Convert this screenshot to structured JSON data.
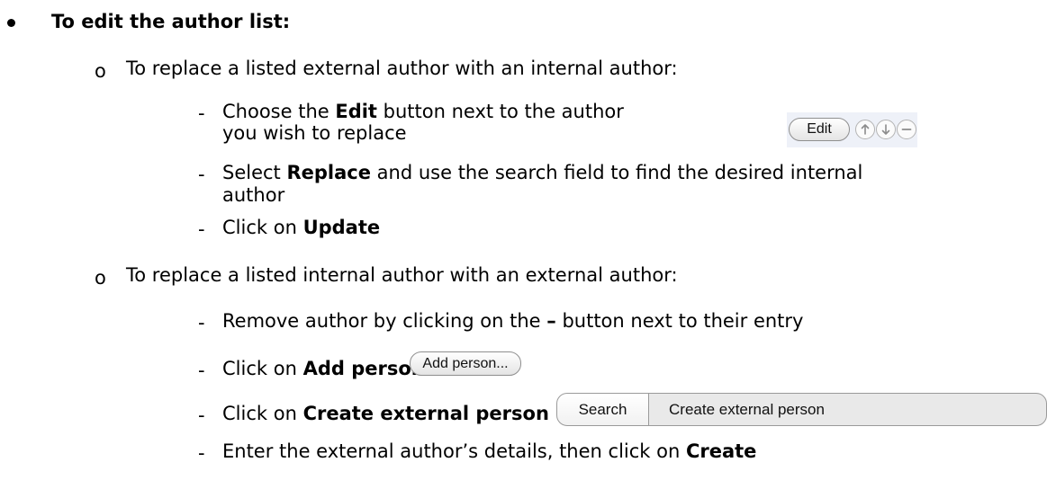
{
  "heading": "To edit the author list:",
  "sections": [
    {
      "title": "To replace a listed external author with an internal author:",
      "steps": [
        {
          "pre": "Choose the ",
          "bold": "Edit",
          "post": " button next to the author",
          "line2": "you wish to replace"
        },
        {
          "pre": "Select ",
          "bold": "Replace",
          "post": " and use the search field to find the desired internal",
          "line2": "author"
        },
        {
          "pre": "Click on ",
          "bold": "Update",
          "post": ""
        }
      ]
    },
    {
      "title": "To replace a listed internal author with an external author:",
      "steps": [
        {
          "pre": "Remove author by clicking on the ",
          "bold": "–",
          "post": " button next to their entry"
        },
        {
          "pre": "Click on ",
          "bold": "Add person",
          "post": ""
        },
        {
          "pre": "Click on ",
          "bold": "Create external person",
          "post": ""
        },
        {
          "pre": "Enter the external author’s details, then click on ",
          "bold": "Create",
          "post": ""
        }
      ]
    }
  ],
  "widgets": {
    "edit_button": "Edit",
    "add_person_button": "Add person...",
    "search_tab": "Search",
    "create_external_tab": "Create external person",
    "move_up_icon": "arrow-up-icon",
    "move_down_icon": "arrow-down-icon",
    "remove_icon": "minus-icon"
  },
  "markers": {
    "sub": "o",
    "step": "-"
  },
  "colors": {
    "widget_panel": "#eef1f8",
    "tab_selected": "#e9e9e9"
  }
}
